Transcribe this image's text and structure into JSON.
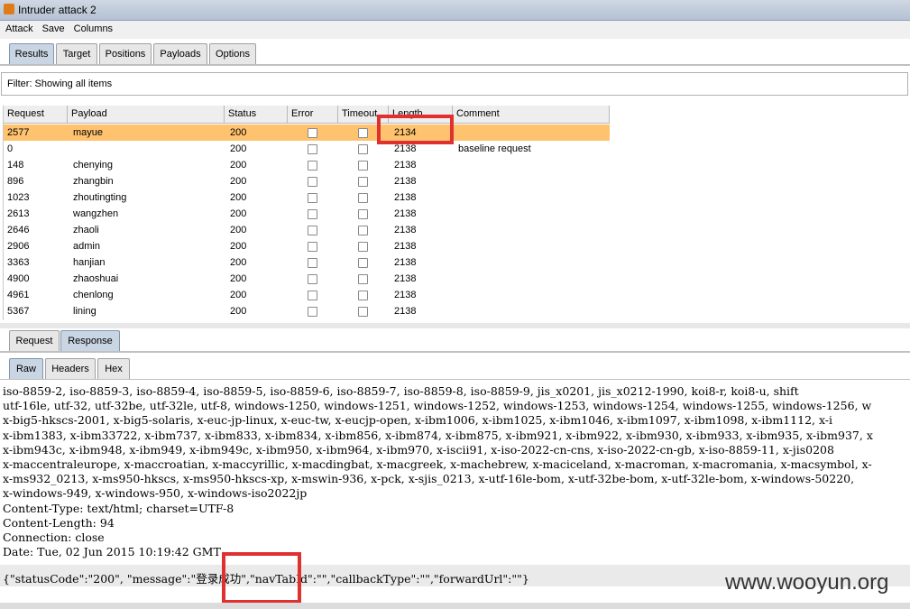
{
  "window": {
    "title": "Intruder attack 2"
  },
  "menu": [
    "Attack",
    "Save",
    "Columns"
  ],
  "main_tabs": [
    "Results",
    "Target",
    "Positions",
    "Payloads",
    "Options"
  ],
  "filter": {
    "text": "Filter: Showing all items"
  },
  "table": {
    "columns": [
      "Request",
      "Payload",
      "Status",
      "Error",
      "Timeout",
      "Length",
      "Comment"
    ],
    "rows": [
      {
        "request": "2577",
        "payload": "mayue",
        "status": "200",
        "length": "2134",
        "comment": "",
        "selected": true
      },
      {
        "request": "0",
        "payload": "",
        "status": "200",
        "length": "2138",
        "comment": "baseline request",
        "selected": false
      },
      {
        "request": "148",
        "payload": "chenying",
        "status": "200",
        "length": "2138",
        "comment": "",
        "selected": false
      },
      {
        "request": "896",
        "payload": "zhangbin",
        "status": "200",
        "length": "2138",
        "comment": "",
        "selected": false
      },
      {
        "request": "1023",
        "payload": "zhoutingting",
        "status": "200",
        "length": "2138",
        "comment": "",
        "selected": false
      },
      {
        "request": "2613",
        "payload": "wangzhen",
        "status": "200",
        "length": "2138",
        "comment": "",
        "selected": false
      },
      {
        "request": "2646",
        "payload": "zhaoli",
        "status": "200",
        "length": "2138",
        "comment": "",
        "selected": false
      },
      {
        "request": "2906",
        "payload": "admin",
        "status": "200",
        "length": "2138",
        "comment": "",
        "selected": false
      },
      {
        "request": "3363",
        "payload": "hanjian",
        "status": "200",
        "length": "2138",
        "comment": "",
        "selected": false
      },
      {
        "request": "4900",
        "payload": "zhaoshuai",
        "status": "200",
        "length": "2138",
        "comment": "",
        "selected": false
      },
      {
        "request": "4961",
        "payload": "chenlong",
        "status": "200",
        "length": "2138",
        "comment": "",
        "selected": false
      },
      {
        "request": "5367",
        "payload": "lining",
        "status": "200",
        "length": "2138",
        "comment": "",
        "selected": false
      }
    ]
  },
  "reqresp_tabs": [
    "Request",
    "Response"
  ],
  "view_tabs": [
    "Raw",
    "Headers",
    "Hex"
  ],
  "response_lines": [
    "iso-8859-2, iso-8859-3, iso-8859-4, iso-8859-5, iso-8859-6, iso-8859-7, iso-8859-8, iso-8859-9, jis_x0201, jis_x0212-1990, koi8-r, koi8-u, shift",
    "utf-16le, utf-32, utf-32be, utf-32le, utf-8, windows-1250, windows-1251, windows-1252, windows-1253, windows-1254, windows-1255, windows-1256, w",
    "x-big5-hkscs-2001, x-big5-solaris, x-euc-jp-linux, x-euc-tw, x-eucjp-open, x-ibm1006, x-ibm1025, x-ibm1046, x-ibm1097, x-ibm1098, x-ibm1112, x-i",
    "x-ibm1383, x-ibm33722, x-ibm737, x-ibm833, x-ibm834, x-ibm856, x-ibm874, x-ibm875, x-ibm921, x-ibm922, x-ibm930, x-ibm933, x-ibm935, x-ibm937, x",
    "x-ibm943c, x-ibm948, x-ibm949, x-ibm949c, x-ibm950, x-ibm964, x-ibm970, x-iscii91, x-iso-2022-cn-cns, x-iso-2022-cn-gb, x-iso-8859-11, x-jis0208",
    "x-maccentraleurope, x-maccroatian, x-maccyrillic, x-macdingbat, x-macgreek, x-machebrew, x-maciceland, x-macroman, x-macromania, x-macsymbol, x-",
    "x-ms932_0213, x-ms950-hkscs, x-ms950-hkscs-xp, x-mswin-936, x-pck, x-sjis_0213, x-utf-16le-bom, x-utf-32be-bom, x-utf-32le-bom, x-windows-50220,",
    "x-windows-949, x-windows-950, x-windows-iso2022jp",
    "Content-Type: text/html; charset=UTF-8",
    "Content-Length: 94",
    "Connection: close",
    "Date: Tue, 02 Jun 2015 10:19:42 GMT"
  ],
  "response_body": "{\"statusCode\":\"200\", \"message\":\"登录成功\",\"navTabId\":\"\",\"callbackType\":\"\",\"forwardUrl\":\"\"}",
  "watermark": "www.wooyun.org",
  "colors": {
    "selected_row": "#ffc36f",
    "highlight": "#e03030"
  }
}
